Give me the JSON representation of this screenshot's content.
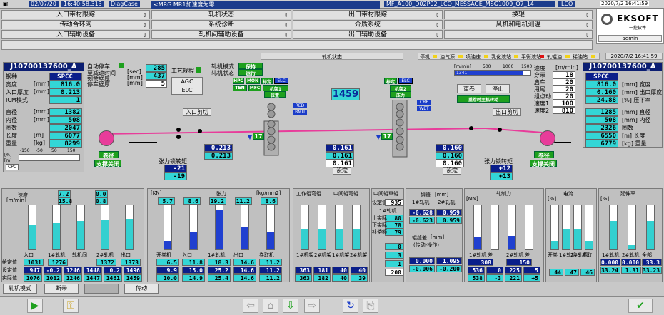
{
  "top": {
    "date": "02/07/20",
    "time": "16:40:58.313",
    "mode": "DiagCase",
    "msg": "<MRG MR1加速度为零",
    "file": "MF_A100_D02P02_LCO_MESSAGE_MSG1009_Q7_14",
    "lco": "LCO",
    "clock": "2020/7/2 16:41:59"
  },
  "menu": {
    "r1": [
      "入口带材跟踪",
      "轧机状态",
      "出口带材跟踪",
      "换辊"
    ],
    "r2": [
      "传动合环网",
      "系统诊断",
      "介质系统",
      "风机和电机测温"
    ],
    "r3": [
      "入口辅助设备",
      "轧机间辅助设备",
      "出口辅助设备"
    ]
  },
  "logo": {
    "brand": "EKSOFT",
    "sub": "一控软件",
    "user": "admin"
  },
  "status": {
    "center": "轧机状态",
    "tags": [
      "停机",
      "油气源",
      "喷油速",
      "乳化液站",
      "平衡液站",
      "轧辊油",
      "稀油站"
    ],
    "clock2": "2020/7/2 16:41:59"
  },
  "left": {
    "id": "J10700137600_A",
    "rows": [
      [
        "钢种",
        "",
        "SPCC"
      ],
      [
        "宽度",
        "[mm]",
        "816.0"
      ],
      [
        "入口厚度",
        "[mm]",
        "0.213"
      ],
      [
        "ICM模式",
        "",
        "1"
      ],
      [
        "直径",
        "[mm]",
        "1382"
      ],
      [
        "内径",
        "[mm]",
        "508"
      ],
      [
        "圈数",
        "",
        "2047"
      ],
      [
        "长度",
        "[m]",
        "6077"
      ],
      [
        "重量",
        "[kg]",
        "8299"
      ]
    ],
    "scale": [
      "-150",
      "-50",
      "50",
      "150"
    ],
    "pct": "[%]",
    "m": "[m]",
    "cpc": "CPC"
  },
  "right": {
    "id": "J10700137600_A",
    "rows": [
      [
        "SPCC",
        ""
      ],
      [
        "816.0",
        "[mm] 宽度"
      ],
      [
        "0.160",
        "[mm] 出口厚度"
      ],
      [
        "24.88",
        "[%] 压下率"
      ],
      [
        "1285",
        "[mm] 直径"
      ],
      [
        "508",
        "[mm] 内径"
      ],
      [
        "2326",
        "圈数"
      ],
      [
        "6550",
        "[m] 长度"
      ],
      [
        "6779",
        "[kg] 重量"
      ]
    ]
  },
  "mid": {
    "autostop": "自动停车",
    "ratespeed": "至减速时间",
    "remain": "剩余壁厚",
    "stopthk": "停车壁厚",
    "units": [
      "[sec]",
      "[mm]",
      "[mm]"
    ],
    "vals": [
      "285",
      "437",
      "5"
    ],
    "proc": "工艺规程",
    "agc": "AGC",
    "elc": "ELC",
    "millmode": "轧机模式",
    "millstate": "轧机状态",
    "mode_v": "保持",
    "state_v": "运行",
    "tags1": [
      "HPC",
      "MON",
      "标定",
      "ELC"
    ],
    "tags2": [
      "TEN",
      "MFC",
      "机架1"
    ],
    "pos": "位置",
    "stand2": [
      "标定",
      "ELC",
      "机架2"
    ],
    "force": "压力",
    "speed_center": "1459",
    "red": "RED",
    "bmu": "BMU",
    "crp": "CRP",
    "wet": "WET",
    "entrycut": "入口剪切",
    "exitcut": "出口剪切",
    "uncoil": "卷径",
    "uncoil2": "支撑关闭",
    "coil": "卷径",
    "coil2": "支撑关闭",
    "s17a": "17",
    "s17b": "17",
    "thk1": [
      "0.213",
      "0.213"
    ],
    "thk2": [
      "0.161",
      "0.161",
      "0.161"
    ],
    "thk3": [
      "0.160",
      "0.160",
      "0.160"
    ],
    "set": "设定",
    "tens_l": "张力锁转矩",
    "tens_l_v": [
      "-21",
      "-19"
    ],
    "tens_r": "张力锁转矩",
    "tens_r_v": [
      "+12",
      "+13"
    ],
    "spd_hdr": [
      "[m/min]",
      "500",
      "1000",
      "1500"
    ],
    "spd_bar": "1341",
    "btn_reset": "重卷",
    "btn_stop": "停止",
    "btn_lock": "重卷时主机转动",
    "sidespeed": {
      "title": "速度",
      "unit": "[m/min]",
      "rows": [
        [
          "穿带",
          "18"
        ],
        [
          "启车",
          "20"
        ],
        [
          "甩尾",
          "20"
        ],
        [
          "组点动",
          "20"
        ],
        [
          "速度1",
          "100"
        ],
        [
          "速度2",
          "810"
        ]
      ]
    }
  },
  "bottom": {
    "speed": {
      "title": "速度",
      "unit": "[m/min]",
      "top": [
        "7.2",
        "15.8",
        "0.0",
        "0.8"
      ],
      "labels": [
        "入口",
        "1#轧机",
        "轧机间",
        "2#轧机",
        "出口"
      ],
      "r1": [
        "1031",
        "1276",
        "1372",
        "1373"
      ],
      "r2": [
        "947",
        "-0.2",
        "1246",
        "1448",
        "0.2",
        "1496"
      ],
      "r3": [
        "1076",
        "1082",
        "1246",
        "1447",
        "1461",
        "1459"
      ],
      "rl": [
        "给定值",
        "设定值",
        "实际值"
      ]
    },
    "tension": {
      "title": "张力",
      "unit": "[kg/mm2]",
      "top": [
        "5.7",
        "8.6",
        "19.2",
        "11.2",
        "8.6"
      ],
      "labels": [
        "开卷机",
        "入口",
        "1#轧机",
        "出口",
        "卷取机"
      ],
      "r1": [
        "6.5",
        "11.8",
        "18.3",
        "14.6",
        "11.2"
      ],
      "r2": [
        "9.9",
        "15.0",
        "25.2",
        "14.6",
        "11.2"
      ],
      "r3": [
        "10.0",
        "14.9",
        "25.4",
        "14.6",
        "11.2"
      ],
      "kn": "[KN]"
    },
    "roll": {
      "title1": "工作辊弯辊",
      "title2": "中间辊弯辊",
      "labels": [
        "1#机架",
        "2#机架",
        "1#机架",
        "2#机架"
      ],
      "r1": [
        "363",
        "181",
        "40",
        "40"
      ],
      "r2": [
        "363",
        "182",
        "40",
        "39"
      ]
    },
    "mid": {
      "title": "中间辊窜辊",
      "set": "设定值",
      "setv": "935",
      "act1": "1#轧机",
      "r1": [
        "80",
        "78",
        "79"
      ],
      "rl": [
        "上实际",
        "下实际",
        "补偿额"
      ],
      "act2": "2#轧机",
      "r2": [
        "0",
        "3",
        "1",
        "200"
      ]
    },
    "gap": {
      "title": "辊缝",
      "unit": "[mm]",
      "h": [
        "1#轧机",
        "2#轧机"
      ],
      "r1": [
        "-0.628",
        "0.959"
      ],
      "r2": [
        "-0.623",
        "0.959"
      ],
      "diff": "辊缝差",
      "diff_unit": "[mm]",
      "diff_sub": "(传动-操作)",
      "d1": [
        "0.000",
        "1.095"
      ],
      "d2": [
        "-0.006",
        "-0.200"
      ]
    },
    "force": {
      "title": "轧制力",
      "unit": "[MN]",
      "labels": [
        "1#轧机",
        "差",
        "2#轧机",
        "差"
      ],
      "t": "[T]",
      "r1": [
        "308",
        "150"
      ],
      "r2": [
        "536",
        "0",
        "225",
        "5"
      ],
      "r3": [
        "538",
        "-3",
        "221",
        "+5"
      ]
    },
    "current": {
      "title": "电流",
      "unit": "[%]",
      "labels": [
        "开卷",
        "1#轧机",
        "2#轧机",
        "卷取"
      ],
      "r": [
        "44",
        "47",
        "46"
      ]
    },
    "elong": {
      "title": "延伸率",
      "unit": "[%]",
      "labels": [
        "1#轧机",
        "2#轧机",
        "全部"
      ],
      "r1": [
        "0.000",
        "0.000",
        "33.3"
      ],
      "r2": [
        "33.24",
        "1.31",
        "33.23"
      ]
    }
  },
  "tabs": [
    "轧机模式",
    "断带",
    "",
    "传动"
  ]
}
